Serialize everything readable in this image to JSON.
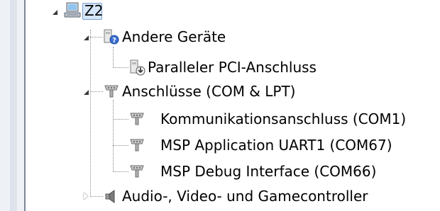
{
  "tree": {
    "root": {
      "label": "Z2",
      "icon": "computer-icon",
      "expanded": true
    },
    "nodes": [
      {
        "id": "andere-geraete",
        "label": "Andere Geräte",
        "icon": "unknown-device-icon",
        "expanded": true,
        "children": [
          {
            "label": "Paralleler PCI-Anschluss",
            "icon": "device-warning-icon"
          }
        ]
      },
      {
        "id": "anschluesse",
        "label": "Anschlüsse (COM & LPT)",
        "icon": "port-icon",
        "expanded": true,
        "children": [
          {
            "label": "Kommunikationsanschluss (COM1)",
            "icon": "port-icon"
          },
          {
            "label": "MSP Application UART1 (COM67)",
            "icon": "port-icon"
          },
          {
            "label": "MSP Debug Interface (COM66)",
            "icon": "port-icon"
          }
        ]
      },
      {
        "id": "audio",
        "label": "Audio-, Video- und Gamecontroller",
        "icon": "speaker-icon",
        "expanded": false
      }
    ]
  },
  "colors": {
    "selection_fill": "#d6e6fb",
    "selection_border": "#7da2ce",
    "connector": "#8a8a8a"
  }
}
